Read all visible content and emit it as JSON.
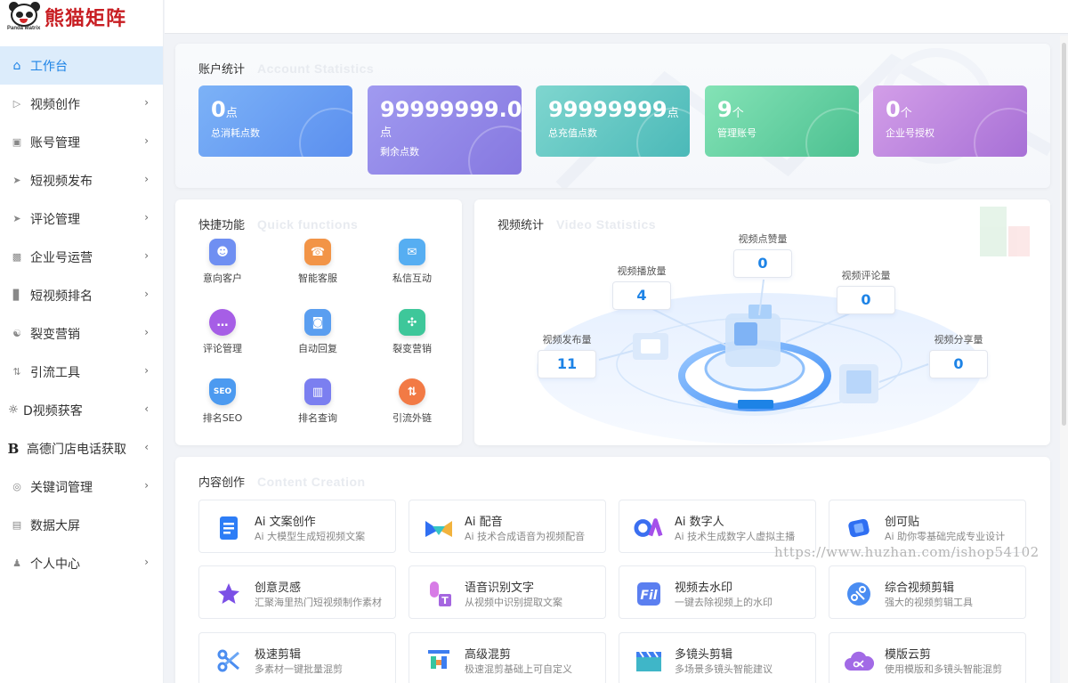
{
  "app": {
    "logo_text": "熊猫矩阵",
    "logo_sub": "Panda Matrix"
  },
  "sidebar": {
    "items": [
      {
        "label": "工作台",
        "icon": "home-icon"
      },
      {
        "label": "视频创作",
        "icon": "video-icon"
      },
      {
        "label": "账号管理",
        "icon": "id-card-icon"
      },
      {
        "label": "短视频发布",
        "icon": "send-icon"
      },
      {
        "label": "评论管理",
        "icon": "send-icon"
      },
      {
        "label": "企业号运营",
        "icon": "monitor-icon"
      },
      {
        "label": "短视频排名",
        "icon": "bar-chart-icon"
      },
      {
        "label": "裂变营销",
        "icon": "network-icon"
      },
      {
        "label": "引流工具",
        "icon": "tools-icon"
      },
      {
        "label": "D视频获客",
        "icon": "handshake-icon"
      },
      {
        "label": "高德门店电话获取",
        "icon": "b-letter-icon"
      },
      {
        "label": "关键词管理",
        "icon": "target-icon"
      },
      {
        "label": "数据大屏",
        "icon": "screen-icon"
      },
      {
        "label": "个人中心",
        "icon": "user-icon"
      }
    ]
  },
  "account": {
    "title": "账户统计",
    "title_en": "Account Statistics",
    "stats": [
      {
        "value": "0",
        "unit": "点",
        "label": "总消耗点数"
      },
      {
        "value": "99999999.00",
        "unit": "点",
        "label": "剩余点数"
      },
      {
        "value": "99999999",
        "unit": "点",
        "label": "总充值点数"
      },
      {
        "value": "9",
        "unit": "个",
        "label": "管理账号"
      },
      {
        "value": "0",
        "unit": "个",
        "label": "企业号授权"
      }
    ]
  },
  "quick": {
    "title": "快捷功能",
    "title_en": "Quick functions",
    "items": [
      {
        "label": "意向客户",
        "color": "#6f8ff2",
        "glyph": "☻"
      },
      {
        "label": "智能客服",
        "color": "#f29447",
        "glyph": "☎"
      },
      {
        "label": "私信互动",
        "color": "#56aef2",
        "glyph": "✉"
      },
      {
        "label": "评论管理",
        "color": "#a65ee6",
        "glyph": "…"
      },
      {
        "label": "自动回复",
        "color": "#5a9ef0",
        "glyph": "◙"
      },
      {
        "label": "裂变营销",
        "color": "#3ec79a",
        "glyph": "✣"
      },
      {
        "label": "排名SEO",
        "color": "#4c9af0",
        "glyph": "S"
      },
      {
        "label": "排名查询",
        "color": "#7b7ff0",
        "glyph": "▥"
      },
      {
        "label": "引流外链",
        "color": "#f27a45",
        "glyph": "⇅"
      }
    ]
  },
  "video": {
    "title": "视频统计",
    "title_en": "Video Statistics",
    "stats": [
      {
        "label": "视频播放量",
        "value": "4"
      },
      {
        "label": "视频点赞量",
        "value": "0"
      },
      {
        "label": "视频评论量",
        "value": "0"
      },
      {
        "label": "视频发布量",
        "value": "11"
      },
      {
        "label": "视频分享量",
        "value": "0"
      }
    ]
  },
  "content": {
    "title": "内容创作",
    "title_en": "Content Creation",
    "cards": [
      {
        "title": "Ai 文案创作",
        "desc": "Ai 大模型生成短视频文案",
        "icon": "document-icon",
        "color": "#2d7df6"
      },
      {
        "title": "Ai 配音",
        "desc": "Ai 技术合成语音为视频配音",
        "icon": "voice-icon",
        "color": "#3b6ff0"
      },
      {
        "title": "Ai 数字人",
        "desc": "Ai 技术生成数字人虚拟主播",
        "icon": "digital-human-icon",
        "color": "#8b54f0"
      },
      {
        "title": "创可贴",
        "desc": "Ai 助你零基础完成专业设计",
        "icon": "bandaid-icon",
        "color": "#2f6ff2"
      },
      {
        "title": "创意灵感",
        "desc": "汇聚海里热门短视频制作素材",
        "icon": "star-icon",
        "color": "#7b4fe6"
      },
      {
        "title": "语音识别文字",
        "desc": "从视频中识别提取文案",
        "icon": "mic-text-icon",
        "color": "#c76be0"
      },
      {
        "title": "视频去水印",
        "desc": "一键去除视频上的水印",
        "icon": "watermark-remove-icon",
        "color": "#5b7ff0"
      },
      {
        "title": "综合视频剪辑",
        "desc": "强大的视频剪辑工具",
        "icon": "scissors-circle-icon",
        "color": "#4a8df2"
      },
      {
        "title": "极速剪辑",
        "desc": "多素材一键批量混剪",
        "icon": "scissors-icon",
        "color": "#4b8df0"
      },
      {
        "title": "高级混剪",
        "desc": "极速混剪基础上可自定义",
        "icon": "mix-edit-icon",
        "color": "#3d7ef0"
      },
      {
        "title": "多镜头剪辑",
        "desc": "多场景多镜头智能建议",
        "icon": "clapper-icon",
        "color": "#3fb6c8"
      },
      {
        "title": "模版云剪",
        "desc": "使用模版和多镜头智能混剪",
        "icon": "cloud-scissors-icon",
        "color": "#a26ae6"
      }
    ]
  },
  "watermark": "https://www.huzhan.com/ishop54102"
}
